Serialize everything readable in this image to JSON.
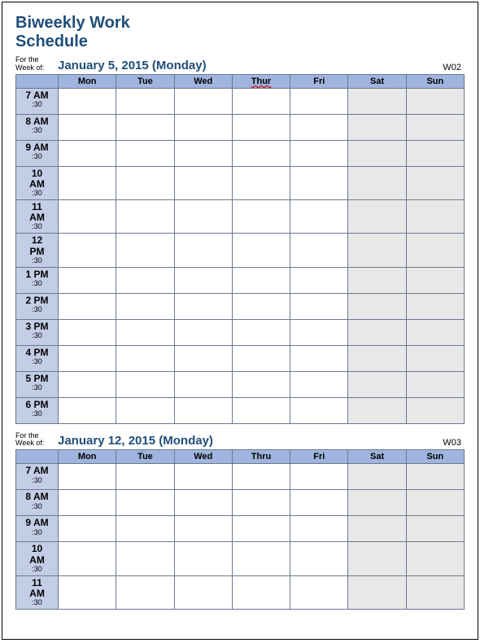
{
  "title_line1": "Biweekly Work",
  "title_line2": "Schedule",
  "for_the_week_label_line1": "For the",
  "for_the_week_label_line2": "Week of:",
  "half_hour_label": ":30",
  "week1": {
    "date": "January 5, 2015 (Monday)",
    "week_number": "W02",
    "days": [
      "Mon",
      "Tue",
      "Wed",
      "Thur",
      "Fri",
      "Sat",
      "Sun"
    ],
    "times": [
      "7 AM",
      "8 AM",
      "9 AM",
      "10 AM",
      "11 AM",
      "12 PM",
      "1 PM",
      "2 PM",
      "3 PM",
      "4 PM",
      "5 PM",
      "6 PM"
    ]
  },
  "week2": {
    "date": "January 12, 2015 (Monday)",
    "week_number": "W03",
    "days": [
      "Mon",
      "Tue",
      "Wed",
      "Thru",
      "Fri",
      "Sat",
      "Sun"
    ],
    "times": [
      "7 AM",
      "8 AM",
      "9 AM",
      "10 AM",
      "11 AM"
    ]
  }
}
